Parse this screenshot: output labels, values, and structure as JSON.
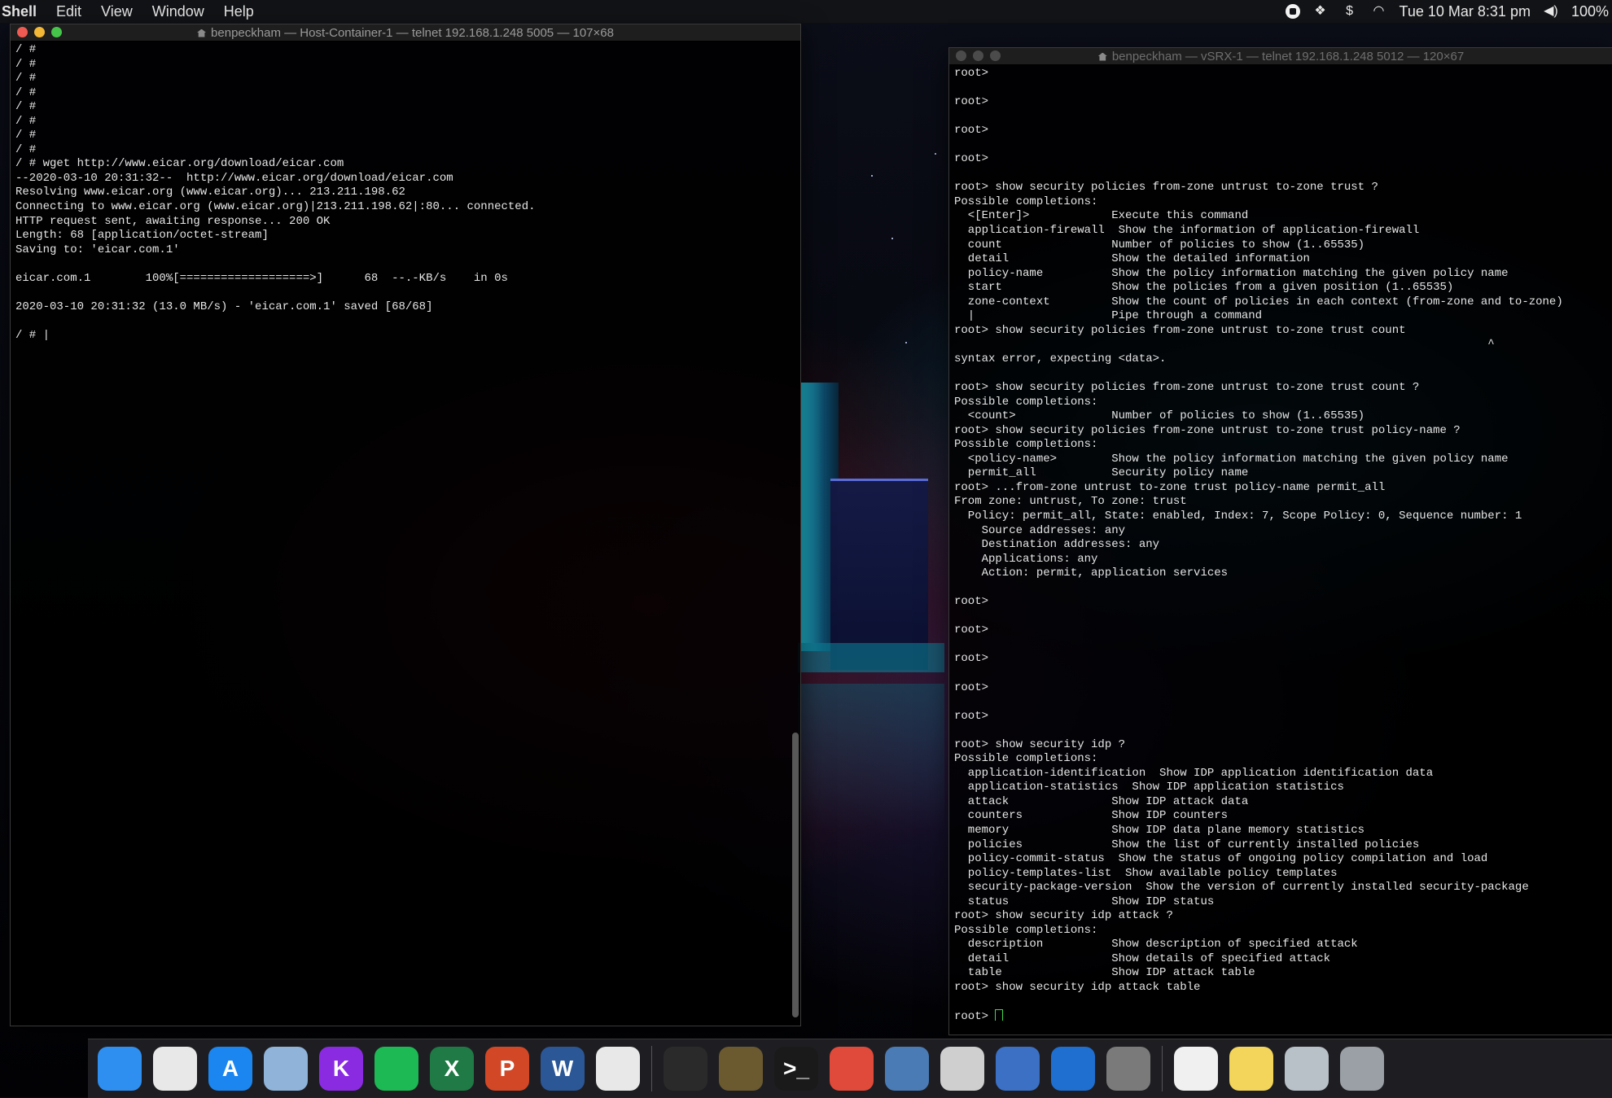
{
  "menubar": {
    "app": "Shell",
    "items": [
      "Edit",
      "View",
      "Window",
      "Help"
    ],
    "clock": "Tue 10 Mar  8:31 pm",
    "battery": "100%"
  },
  "left_window": {
    "title": "benpeckham — Host-Container-1 — telnet 192.168.1.248 5005 — 107×68",
    "lines": [
      "/ #",
      "/ #",
      "/ #",
      "/ #",
      "/ #",
      "/ #",
      "/ #",
      "/ #",
      "/ # wget http://www.eicar.org/download/eicar.com",
      "--2020-03-10 20:31:32--  http://www.eicar.org/download/eicar.com",
      "Resolving www.eicar.org (www.eicar.org)... 213.211.198.62",
      "Connecting to www.eicar.org (www.eicar.org)|213.211.198.62|:80... connected.",
      "HTTP request sent, awaiting response... 200 OK",
      "Length: 68 [application/octet-stream]",
      "Saving to: 'eicar.com.1'",
      "",
      "eicar.com.1        100%[===================>]      68  --.-KB/s    in 0s",
      "",
      "2020-03-10 20:31:32 (13.0 MB/s) - 'eicar.com.1' saved [68/68]",
      "",
      "/ # |"
    ]
  },
  "right_window": {
    "title": "benpeckham — vSRX-1 — telnet 192.168.1.248 5012 — 120×67",
    "lines": [
      "root>",
      "",
      "root>",
      "",
      "root>",
      "",
      "root>",
      "",
      "root> show security policies from-zone untrust to-zone trust ?",
      "Possible completions:",
      "  <[Enter]>            Execute this command",
      "  application-firewall  Show the information of application-firewall",
      "  count                Number of policies to show (1..65535)",
      "  detail               Show the detailed information",
      "  policy-name          Show the policy information matching the given policy name",
      "  start                Show the policies from a given position (1..65535)",
      "  zone-context         Show the count of policies in each context (from-zone and to-zone)",
      "  |                    Pipe through a command",
      "root> show security policies from-zone untrust to-zone trust count",
      "                                                                              ^",
      "syntax error, expecting <data>.",
      "",
      "root> show security policies from-zone untrust to-zone trust count ?",
      "Possible completions:",
      "  <count>              Number of policies to show (1..65535)",
      "root> show security policies from-zone untrust to-zone trust policy-name ?",
      "Possible completions:",
      "  <policy-name>        Show the policy information matching the given policy name",
      "  permit_all           Security policy name",
      "root> ...from-zone untrust to-zone trust policy-name permit_all",
      "From zone: untrust, To zone: trust",
      "  Policy: permit_all, State: enabled, Index: 7, Scope Policy: 0, Sequence number: 1",
      "    Source addresses: any",
      "    Destination addresses: any",
      "    Applications: any",
      "    Action: permit, application services",
      "",
      "root>",
      "",
      "root>",
      "",
      "root>",
      "",
      "root>",
      "",
      "root>",
      "",
      "root> show security idp ?",
      "Possible completions:",
      "  application-identification  Show IDP application identification data",
      "  application-statistics  Show IDP application statistics",
      "  attack               Show IDP attack data",
      "  counters             Show IDP counters",
      "  memory               Show IDP data plane memory statistics",
      "  policies             Show the list of currently installed policies",
      "  policy-commit-status  Show the status of ongoing policy compilation and load",
      "  policy-templates-list  Show available policy templates",
      "  security-package-version  Show the version of currently installed security-package",
      "  status               Show IDP status",
      "root> show security idp attack ?",
      "Possible completions:",
      "  description          Show description of specified attack",
      "  detail               Show details of specified attack",
      "  table                Show IDP attack table",
      "root> show security idp attack table",
      ""
    ],
    "prompt": "root> "
  },
  "dock": {
    "apps": [
      {
        "name": "finder-icon",
        "glyph": "",
        "color": "#2f8ff0"
      },
      {
        "name": "photos-icon",
        "glyph": "",
        "color": "#e8e8e8"
      },
      {
        "name": "app-store-icon",
        "glyph": "A",
        "color": "#1b86f0"
      },
      {
        "name": "preview-icon",
        "glyph": "",
        "color": "#8fb3d9"
      },
      {
        "name": "keynote-k-icon",
        "glyph": "K",
        "color": "#8a2be2"
      },
      {
        "name": "spotify-icon",
        "glyph": "",
        "color": "#1db954"
      },
      {
        "name": "excel-icon",
        "glyph": "X",
        "color": "#1f7a45"
      },
      {
        "name": "powerpoint-icon",
        "glyph": "P",
        "color": "#d24726"
      },
      {
        "name": "word-icon",
        "glyph": "W",
        "color": "#2b5797"
      },
      {
        "name": "chrome-icon",
        "glyph": "",
        "color": "#e8e8e8"
      },
      {
        "name": "activity-monitor-icon",
        "glyph": "",
        "color": "#2a2a2a"
      },
      {
        "name": "radar-icon",
        "glyph": "",
        "color": "#6b5a30"
      },
      {
        "name": "terminal-icon",
        "glyph": ">_",
        "color": "#1a1a1a"
      },
      {
        "name": "remote-desktop-icon",
        "glyph": "",
        "color": "#e04a3a"
      },
      {
        "name": "virtualbox-icon",
        "glyph": "",
        "color": "#4a7bb5"
      },
      {
        "name": "screenshot-icon",
        "glyph": "",
        "color": "#cfcfcf"
      },
      {
        "name": "wireshark-icon",
        "glyph": "",
        "color": "#3b70c4"
      },
      {
        "name": "shark-fin-icon",
        "glyph": "",
        "color": "#1f6fd0"
      },
      {
        "name": "system-preferences-icon",
        "glyph": "",
        "color": "#7a7a7a"
      },
      {
        "name": "textedit-icon",
        "glyph": "",
        "color": "#f0f0f0"
      },
      {
        "name": "stickies-icon",
        "glyph": "",
        "color": "#f3d55b"
      },
      {
        "name": "downloads-stack-icon",
        "glyph": "",
        "color": "#b8c0c8"
      },
      {
        "name": "trash-icon",
        "glyph": "",
        "color": "#9aa0a6"
      }
    ]
  }
}
